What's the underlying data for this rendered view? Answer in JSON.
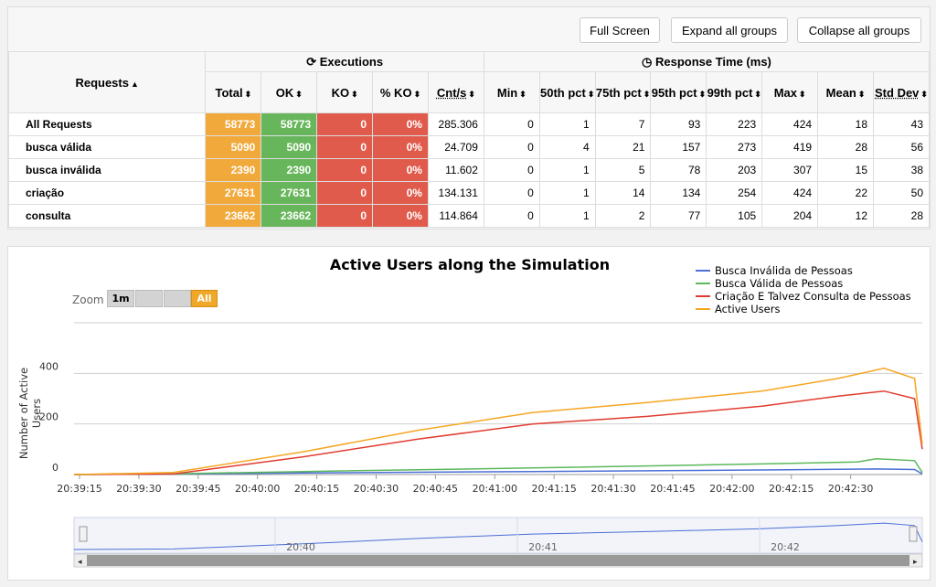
{
  "toolbar": {
    "full_screen": "Full Screen",
    "expand": "Expand all groups",
    "collapse": "Collapse all groups"
  },
  "table": {
    "requests_header": "Requests",
    "executions_header": "Executions",
    "response_header": "Response Time (ms)",
    "columns": [
      "Total",
      "OK",
      "KO",
      "% KO",
      "Cnt/s",
      "Min",
      "50th pct",
      "75th pct",
      "95th pct",
      "99th pct",
      "Max",
      "Mean",
      "Std Dev"
    ],
    "rows": [
      {
        "name": "All Requests",
        "values": [
          "58773",
          "58773",
          "0",
          "0%",
          "285.306",
          "0",
          "1",
          "7",
          "93",
          "223",
          "424",
          "18",
          "43"
        ]
      },
      {
        "name": "busca válida",
        "values": [
          "5090",
          "5090",
          "0",
          "0%",
          "24.709",
          "0",
          "4",
          "21",
          "157",
          "273",
          "419",
          "28",
          "56"
        ]
      },
      {
        "name": "busca inválida",
        "values": [
          "2390",
          "2390",
          "0",
          "0%",
          "11.602",
          "0",
          "1",
          "5",
          "78",
          "203",
          "307",
          "15",
          "38"
        ]
      },
      {
        "name": "criação",
        "values": [
          "27631",
          "27631",
          "0",
          "0%",
          "134.131",
          "0",
          "1",
          "14",
          "134",
          "254",
          "424",
          "22",
          "50"
        ]
      },
      {
        "name": "consulta",
        "values": [
          "23662",
          "23662",
          "0",
          "0%",
          "114.864",
          "0",
          "1",
          "2",
          "77",
          "105",
          "204",
          "12",
          "28"
        ]
      }
    ]
  },
  "chart": {
    "zoom_label": "Zoom",
    "zoom_buttons": [
      "1m",
      "",
      "",
      "All"
    ],
    "navigator_labels": [
      "20:40",
      "20:41",
      "20:42"
    ]
  },
  "chart_data": {
    "type": "line",
    "title": "Active Users along the Simulation",
    "ylabel": "Number of Active Users",
    "xlabel": "",
    "ylim": [
      0,
      600
    ],
    "yticks": [
      0,
      200,
      400
    ],
    "x_ticks": [
      "20:39:15",
      "20:39:30",
      "20:39:45",
      "20:40:00",
      "20:40:15",
      "20:40:30",
      "20:40:45",
      "20:41:00",
      "20:41:15",
      "20:41:30",
      "20:41:45",
      "20:42:00",
      "20:42:15",
      "20:42:30"
    ],
    "x_range_seconds": [
      0,
      222
    ],
    "series": [
      {
        "name": "Busca Inválida de Pessoas",
        "color": "#4a6fd6",
        "x": [
          0,
          26,
          60,
          120,
          180,
          210,
          220,
          222
        ],
        "values": [
          0,
          2,
          6,
          12,
          18,
          22,
          20,
          2
        ]
      },
      {
        "name": "Busca Válida de Pessoas",
        "color": "#5cb85c",
        "x": [
          0,
          26,
          60,
          120,
          180,
          205,
          210,
          220,
          222
        ],
        "values": [
          0,
          3,
          12,
          26,
          42,
          50,
          62,
          55,
          8
        ]
      },
      {
        "name": "Criação E Talvez Consulta de Pessoas",
        "color": "#e03c31",
        "x": [
          0,
          26,
          60,
          90,
          120,
          150,
          180,
          200,
          212,
          220,
          222
        ],
        "values": [
          0,
          2,
          70,
          140,
          200,
          230,
          270,
          310,
          330,
          300,
          100
        ]
      },
      {
        "name": "Active Users",
        "color": "#f5a623",
        "x": [
          0,
          26,
          60,
          90,
          120,
          150,
          180,
          200,
          212,
          220,
          222
        ],
        "values": [
          0,
          8,
          90,
          175,
          245,
          285,
          330,
          380,
          420,
          380,
          120
        ]
      }
    ],
    "grid": true,
    "legend": "top-right"
  }
}
